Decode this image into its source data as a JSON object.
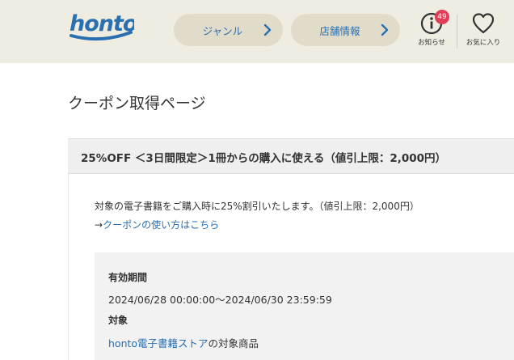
{
  "header": {
    "logo_text": "honto",
    "nav": [
      {
        "label": "ジャンル"
      },
      {
        "label": "店舗情報"
      }
    ],
    "notifications": {
      "label": "お知らせ",
      "count": "49"
    },
    "favorites": {
      "label": "お気に入り"
    }
  },
  "page": {
    "title": "クーポン取得ページ"
  },
  "coupon": {
    "title": "25%OFF ＜3日間限定＞1冊からの購入に使える（値引上限：2,000円）",
    "description": "対象の電子書籍をご購入時に25%割引いたします。（値引上限：2,000円）",
    "howto_arrow": "→",
    "howto_link": "クーポンの使い方はこちら",
    "period_label": "有効期間",
    "period_value": "2024/06/28 00:00:00～2024/06/30 23:59:59",
    "target_label": "対象",
    "target_store_link": "honto電子書籍ストア",
    "target_suffix": "の対象商品"
  },
  "colors": {
    "brand_blue": "#2a6fb0",
    "header_bg": "#efece1",
    "badge_red": "#e23d57"
  }
}
